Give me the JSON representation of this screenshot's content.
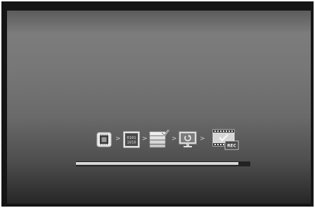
{
  "steps": [
    {
      "name": "chip-icon"
    },
    {
      "name": "binary-data-icon",
      "text_top": "0101",
      "text_bottom": "1010"
    },
    {
      "name": "stacked-layers-check-icon"
    },
    {
      "name": "monitor-refresh-icon"
    },
    {
      "name": "film-record-icon",
      "badge": "REC"
    }
  ],
  "separators": [
    ">",
    ">",
    ">",
    ">"
  ],
  "progress": {
    "fraction": 0.93
  },
  "colors": {
    "fill": "#e6e6e6",
    "track": "#222222",
    "icon_light": "#e8e8e8",
    "icon_dark": "#3a3a3a"
  }
}
